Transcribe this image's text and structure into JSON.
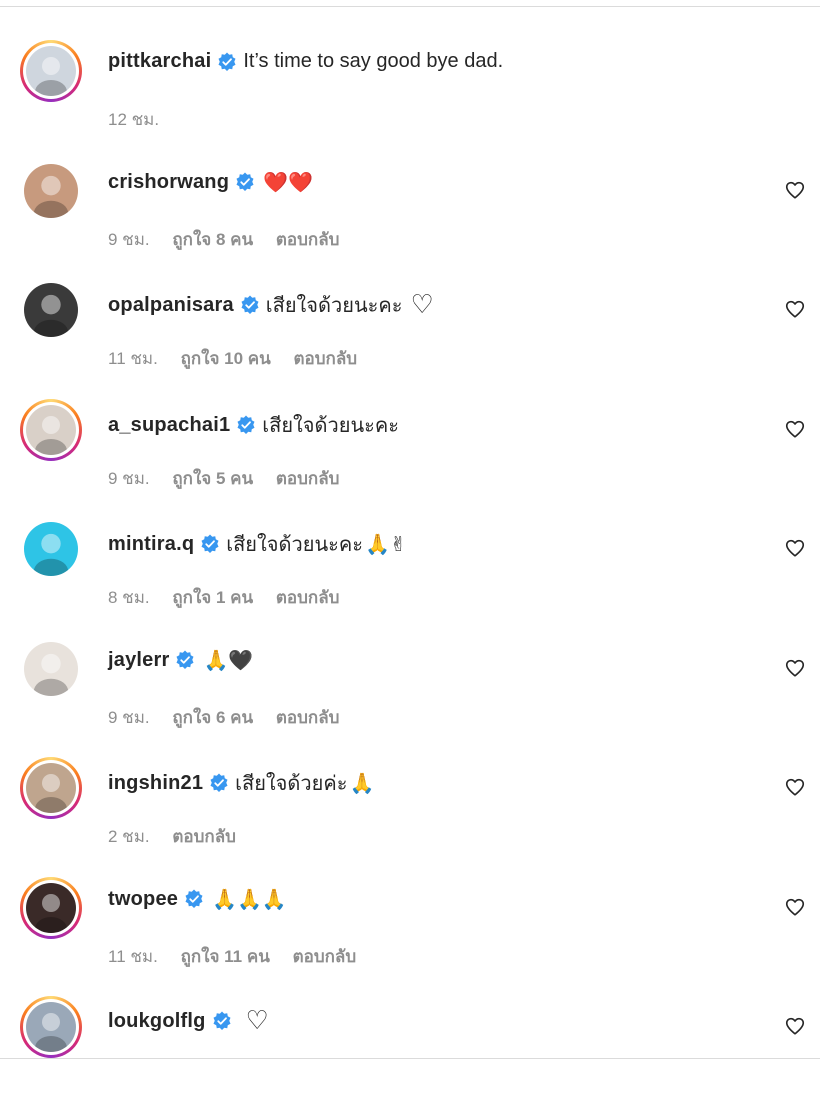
{
  "comments": [
    {
      "username": "pittkarchai",
      "text": "It’s time to say good bye dad.",
      "emoji": "",
      "time": "12 ชม.",
      "likes": "",
      "reply": "",
      "has_like_button": false,
      "avatar_ring": true,
      "avatar_color": "#cfd6de"
    },
    {
      "username": "crishorwang",
      "text": "",
      "emoji": "❤️❤️",
      "time": "9 ชม.",
      "likes": "ถูกใจ 8 คน",
      "reply": "ตอบกลับ",
      "has_like_button": true,
      "avatar_ring": false,
      "avatar_color": "#c79a7e"
    },
    {
      "username": "opalpanisara",
      "text": "เสียใจด้วยนะคะ",
      "emoji": "♡",
      "time": "11 ชม.",
      "likes": "ถูกใจ 10 คน",
      "reply": "ตอบกลับ",
      "has_like_button": true,
      "avatar_ring": false,
      "avatar_color": "#3a3a3a"
    },
    {
      "username": "a_supachai1",
      "text": "เสียใจด้วยนะคะ",
      "emoji": "",
      "time": "9 ชม.",
      "likes": "ถูกใจ 5 คน",
      "reply": "ตอบกลับ",
      "has_like_button": true,
      "avatar_ring": true,
      "avatar_color": "#d9d0c8"
    },
    {
      "username": "mintira.q",
      "text": "เสียใจด้วยนะคะ",
      "emoji": "🙏✌",
      "time": "8 ชม.",
      "likes": "ถูกใจ 1 คน",
      "reply": "ตอบกลับ",
      "has_like_button": true,
      "avatar_ring": false,
      "avatar_color": "#2ec4e6"
    },
    {
      "username": "jaylerr",
      "text": "",
      "emoji": "🙏🖤",
      "time": "9 ชม.",
      "likes": "ถูกใจ 6 คน",
      "reply": "ตอบกลับ",
      "has_like_button": true,
      "avatar_ring": false,
      "avatar_color": "#e8e2dc"
    },
    {
      "username": "ingshin21",
      "text": "เสียใจด้วยค่ะ",
      "emoji": "🙏",
      "time": "2 ชม.",
      "likes": "",
      "reply": "ตอบกลับ",
      "has_like_button": true,
      "avatar_ring": true,
      "avatar_color": "#bfa58e"
    },
    {
      "username": "twopee",
      "text": "",
      "emoji": "🙏🙏🙏",
      "time": "11 ชม.",
      "likes": "ถูกใจ 11 คน",
      "reply": "ตอบกลับ",
      "has_like_button": true,
      "avatar_ring": true,
      "avatar_color": "#3a2a28"
    },
    {
      "username": "loukgolflg",
      "text": "",
      "emoji": "♡",
      "time": "",
      "likes": "",
      "reply": "",
      "has_like_button": true,
      "avatar_ring": true,
      "avatar_color": "#9aa8b8"
    }
  ],
  "colors": {
    "verified_badge": "#3897f0",
    "meta_text": "#8e8e8e",
    "username": "#262626"
  }
}
